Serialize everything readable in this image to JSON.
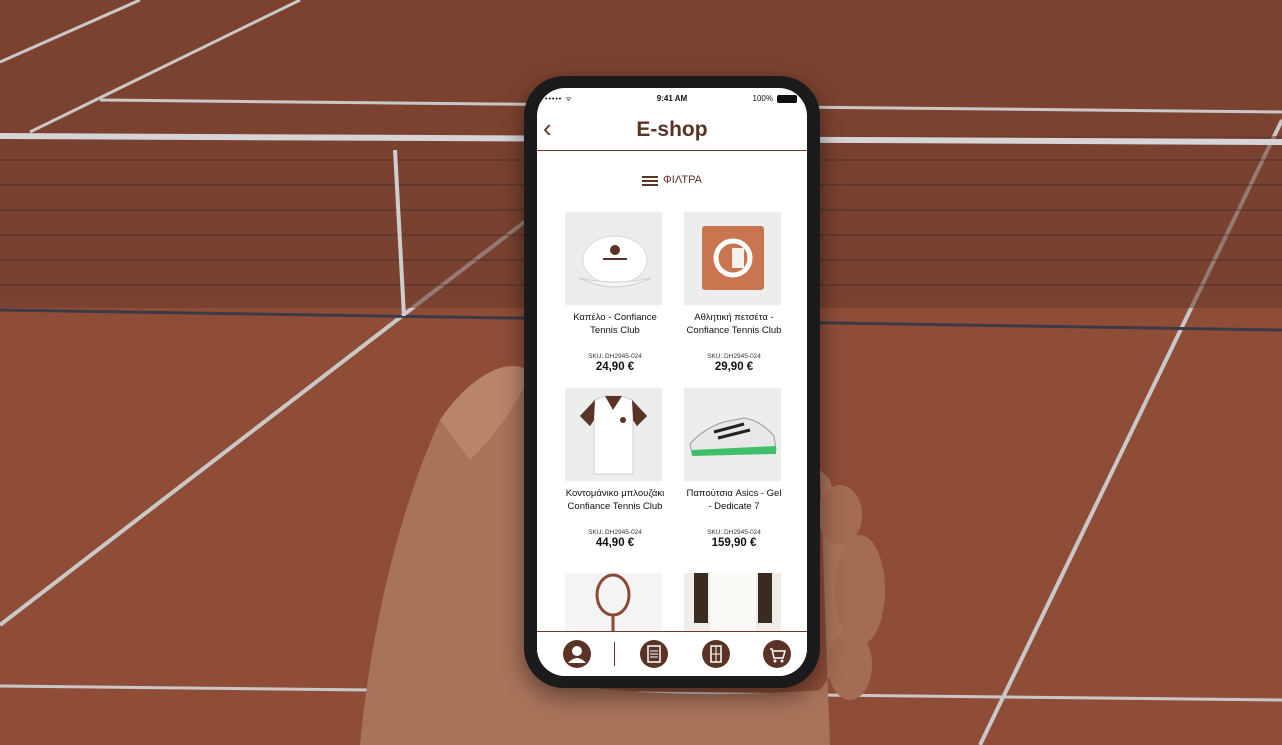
{
  "status": {
    "signal": "••••• ᯤ",
    "time": "9:41 AM",
    "battery": "100%"
  },
  "nav": {
    "back_icon": "‹",
    "title": "E-shop"
  },
  "filters": {
    "label": "ΦΙΛΤΡΑ"
  },
  "products": [
    {
      "name": "Καπέλο - Confiance Tennis Club",
      "sku": "SKU: DH2945-024",
      "price": "24,90 €",
      "image": "cap-image"
    },
    {
      "name": "Αθλητική πετσέτα - Confiance Tennis Club",
      "sku": "SKU: DH2945-024",
      "price": "29,90 €",
      "image": "towel-image"
    },
    {
      "name": "Κοντομάνικο μπλουζάκι Confiance Tennis Club",
      "sku": "SKU: DH2945-024",
      "price": "44,90 €",
      "image": "polo-shirt-image"
    },
    {
      "name": "Παπούτσια Asics - Gel - Dedicate 7",
      "sku": "SKU: DH2945-024",
      "price": "159,90 €",
      "image": "shoe-image"
    }
  ],
  "bottom_nav": [
    {
      "icon": "user-icon"
    },
    {
      "icon": "list-icon"
    },
    {
      "icon": "court-icon"
    },
    {
      "icon": "cart-icon"
    }
  ],
  "colors": {
    "accent": "#5a3226",
    "clay": "#8a4a36",
    "screen_bg": "#ffffff"
  }
}
